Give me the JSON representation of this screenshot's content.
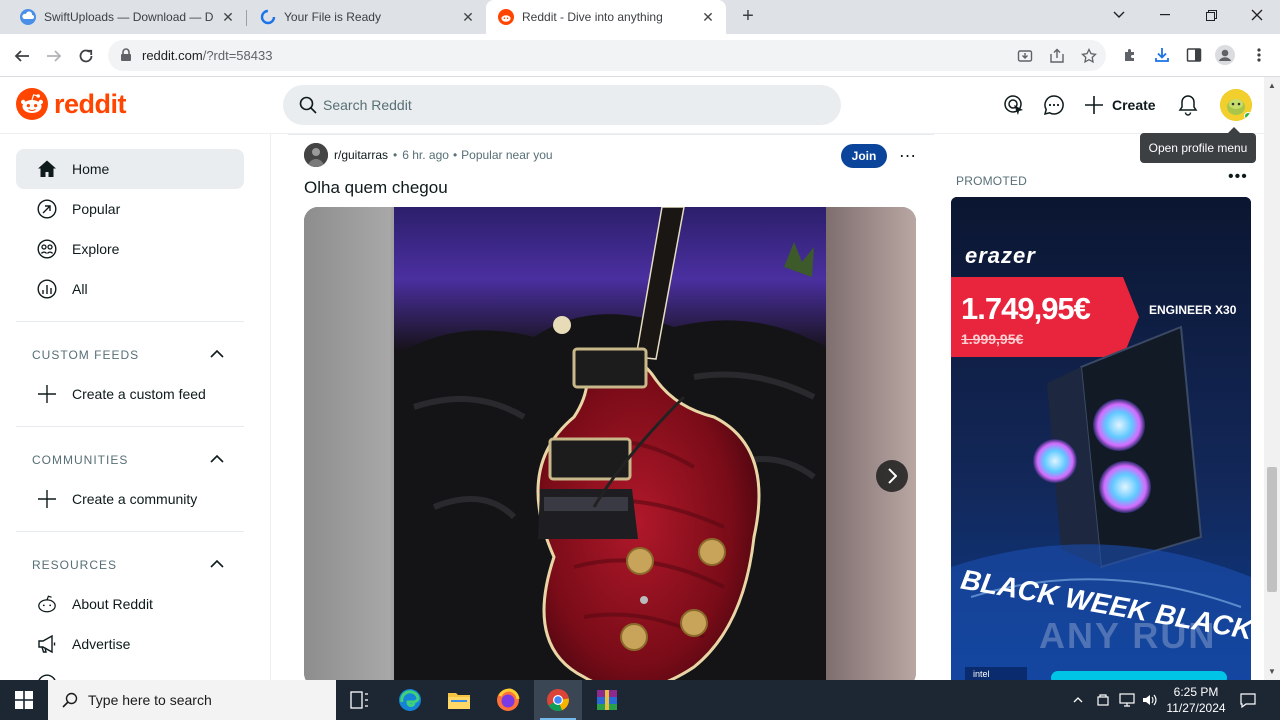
{
  "browser": {
    "tabs": [
      {
        "title": "SwiftUploads — Download — DO",
        "active": false
      },
      {
        "title": "Your File is Ready",
        "active": false
      },
      {
        "title": "Reddit - Dive into anything",
        "active": true
      }
    ],
    "url_host": "reddit.com",
    "url_path": "/?rdt=58433"
  },
  "header": {
    "logo": "reddit",
    "search_placeholder": "Search Reddit",
    "create_label": "Create",
    "tooltip": "Open profile menu"
  },
  "sidebar": {
    "nav": [
      {
        "label": "Home",
        "icon": "home-icon",
        "active": true
      },
      {
        "label": "Popular",
        "icon": "popular-icon"
      },
      {
        "label": "Explore",
        "icon": "explore-icon"
      },
      {
        "label": "All",
        "icon": "all-icon"
      }
    ],
    "custom_feeds": {
      "heading": "CUSTOM FEEDS",
      "action": "Create a custom feed"
    },
    "communities": {
      "heading": "COMMUNITIES",
      "action": "Create a community"
    },
    "resources": {
      "heading": "RESOURCES",
      "items": [
        "About Reddit",
        "Advertise"
      ]
    }
  },
  "post": {
    "subreddit": "r/guitarras",
    "age": "6 hr. ago",
    "context": "Popular near you",
    "join_label": "Join",
    "title": "Olha quem chegou"
  },
  "ad": {
    "label": "PROMOTED",
    "brand": "erazer",
    "price": "1.749,95€",
    "old_price": "1.999,95€",
    "model": "ENGINEER X30",
    "banner": "BLACK WEEK BLACK",
    "chip": "intel",
    "watermark": "ANY RUN"
  },
  "taskbar": {
    "search_placeholder": "Type here to search",
    "time": "6:25 PM",
    "date": "11/27/2024"
  },
  "colors": {
    "reddit_orange": "#ff4500",
    "join_blue": "#0a449b",
    "taskbar": "#1c2733"
  }
}
